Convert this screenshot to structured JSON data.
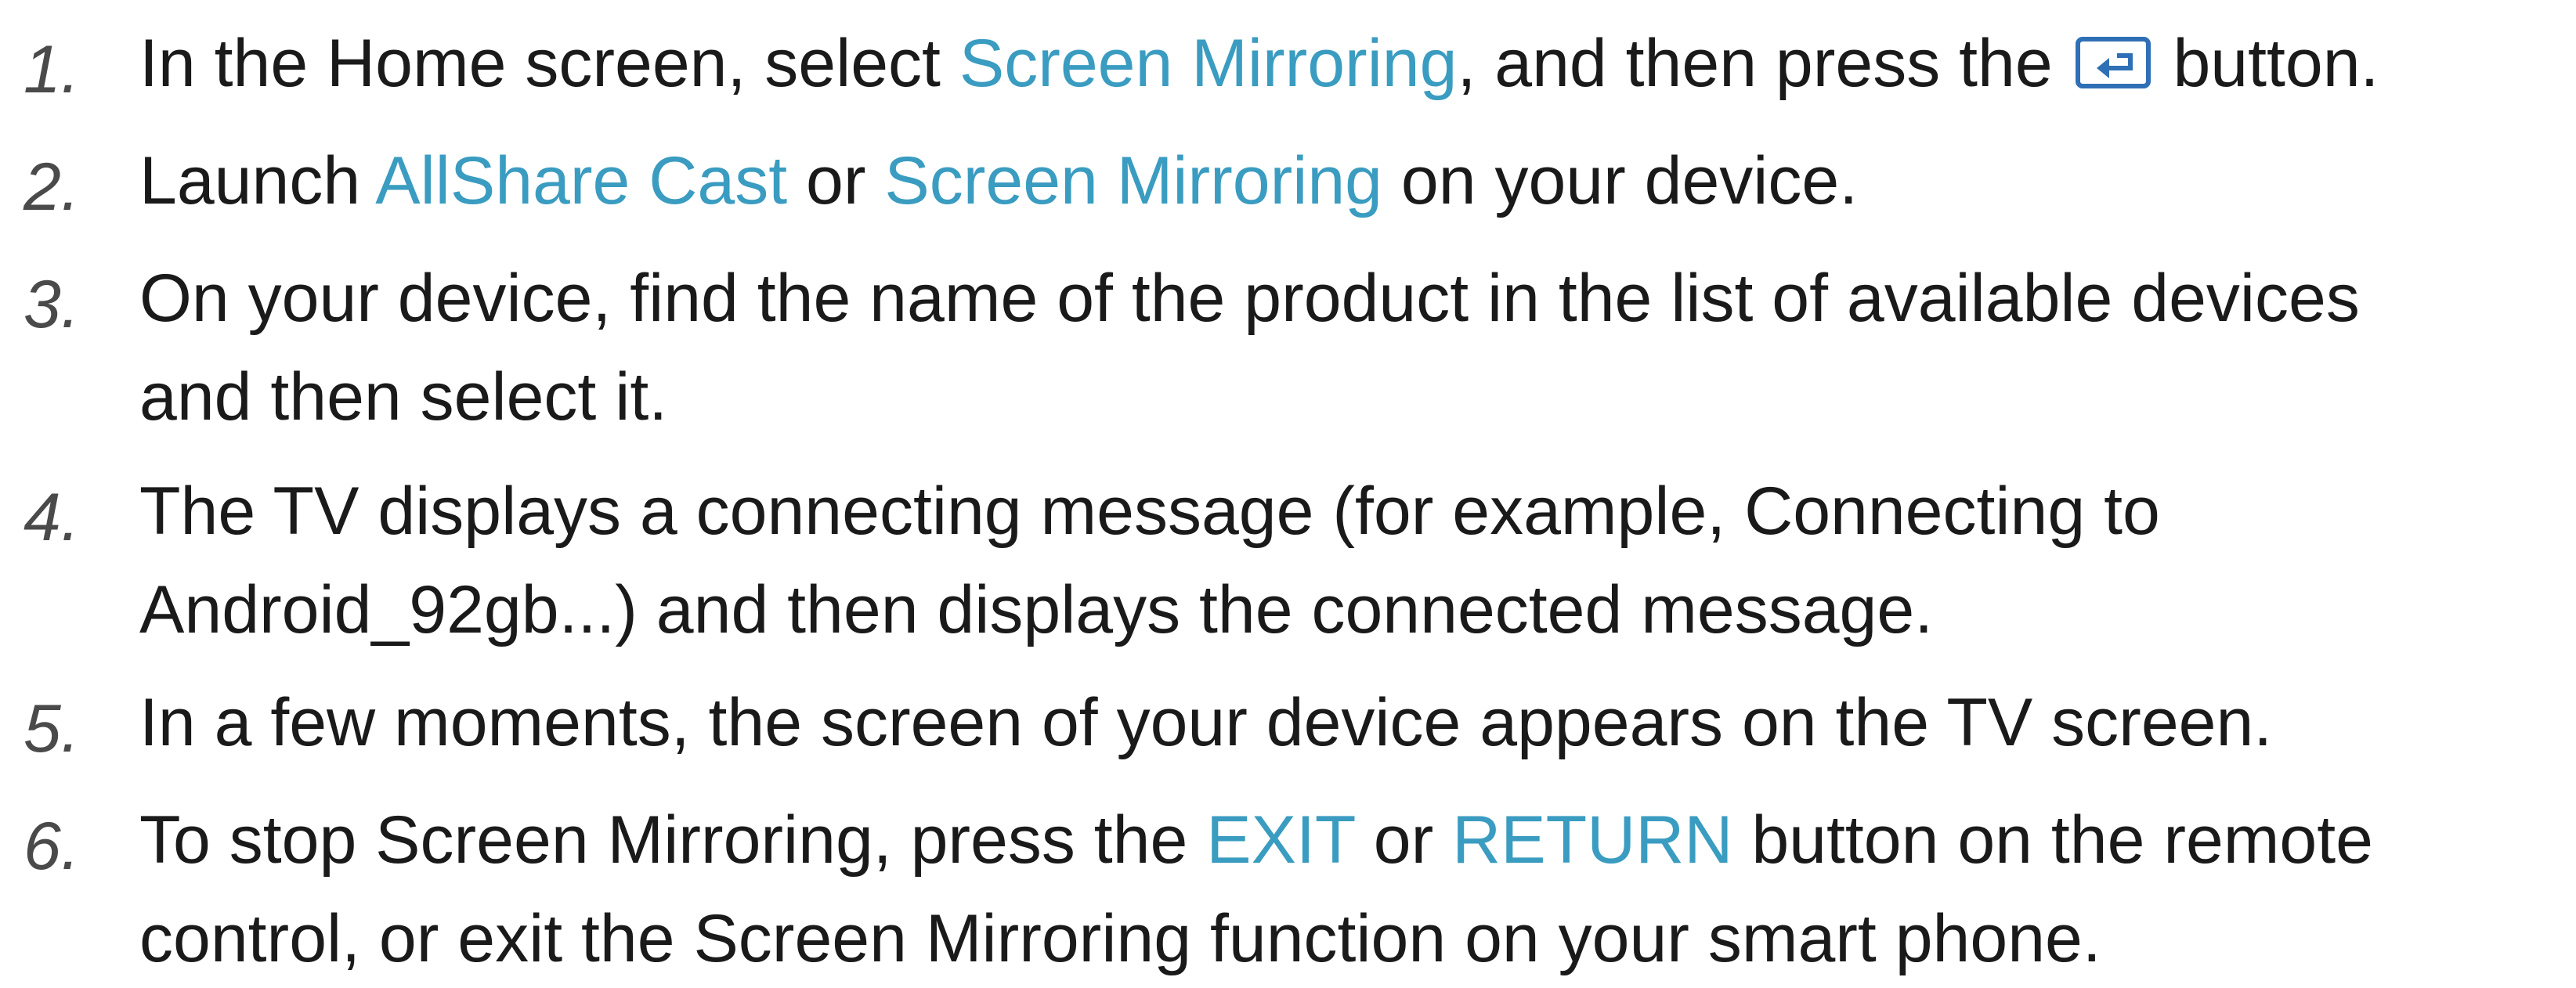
{
  "steps": [
    {
      "number": "1.",
      "lines": [
        [
          {
            "text": "In the Home screen, select ",
            "hl": false
          },
          {
            "text": "Screen Mirroring",
            "hl": true
          },
          {
            "text": ", and then press the ",
            "hl": false
          },
          {
            "icon": "enter-icon"
          },
          {
            "text": " button.",
            "hl": false
          }
        ]
      ]
    },
    {
      "number": "2.",
      "lines": [
        [
          {
            "text": "Launch ",
            "hl": false
          },
          {
            "text": "AllShare Cast",
            "hl": true
          },
          {
            "text": " or ",
            "hl": false
          },
          {
            "text": "Screen Mirroring",
            "hl": true
          },
          {
            "text": " on your device.",
            "hl": false
          }
        ]
      ]
    },
    {
      "number": "3.",
      "lines": [
        [
          {
            "text": "On your device, find the name of the product in the list of available devices",
            "hl": false
          }
        ],
        [
          {
            "text": "and then select it.",
            "hl": false
          }
        ]
      ]
    },
    {
      "number": "4.",
      "lines": [
        [
          {
            "text": "The TV displays a connecting message (for example, Connecting to",
            "hl": false
          }
        ],
        [
          {
            "text": "Android_92gb...) and then displays the connected message.",
            "hl": false
          }
        ]
      ]
    },
    {
      "number": "5.",
      "lines": [
        [
          {
            "text": "In a few moments, the screen of your device appears on the TV screen.",
            "hl": false
          }
        ]
      ]
    },
    {
      "number": "6.",
      "lines": [
        [
          {
            "text": "To stop Screen Mirroring, press the ",
            "hl": false
          },
          {
            "text": "EXIT",
            "hl": true
          },
          {
            "text": " or ",
            "hl": false
          },
          {
            "text": "RETURN",
            "hl": true
          },
          {
            "text": " button on the remote",
            "hl": false
          }
        ],
        [
          {
            "text": "control, or exit the Screen Mirroring function on your smart phone.",
            "hl": false
          }
        ]
      ]
    }
  ],
  "colors": {
    "text": "#1a1a1a",
    "number": "#4a4a4a",
    "highlight": "#3a9cc0",
    "icon": "#2f6fb5"
  }
}
